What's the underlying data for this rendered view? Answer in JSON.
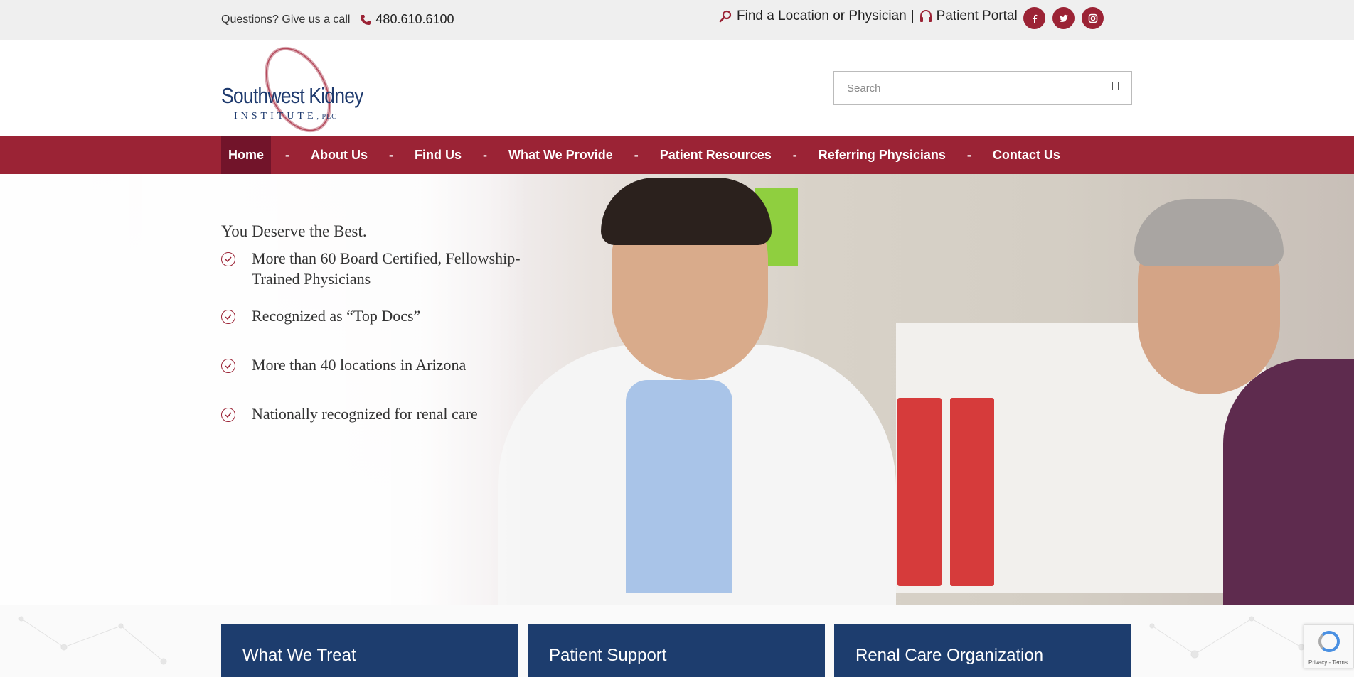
{
  "topbar": {
    "call_prompt": "Questions? Give us a call",
    "phone": "480.610.6100",
    "find_link": "Find a Location or Physician",
    "separator": "|",
    "portal_link": "Patient Portal",
    "social": [
      {
        "icon": "facebook-icon",
        "glyph": "f"
      },
      {
        "icon": "twitter-icon",
        "glyph": "t"
      },
      {
        "icon": "instagram-icon",
        "glyph": "ig"
      }
    ]
  },
  "header": {
    "logo_name": "Southwest Kidney",
    "logo_sub": "INSTITUTE",
    "logo_plc": ", PLC",
    "search_placeholder": "Search"
  },
  "nav": {
    "items": [
      "Home",
      "About Us",
      "Find Us",
      "What We Provide",
      "Patient Resources",
      "Referring Physicians",
      "Contact Us"
    ],
    "separator": "-",
    "active": "Home"
  },
  "hero": {
    "heading": "You Deserve the Best.",
    "points": [
      "More than 60 Board Certified, Fellowship-Trained Physicians",
      "Recognized as “Top Docs”",
      "More than 40 locations in Arizona",
      "Nationally recognized for renal care"
    ]
  },
  "cards": [
    "What We Treat",
    "Patient Support",
    "Renal Care Organization"
  ],
  "recaptcha": {
    "label": "Privacy - Terms"
  },
  "colors": {
    "brand": "#9b2335",
    "brand_dark": "#72142a",
    "navy": "#1d3d6e",
    "topbar_bg": "#efefef"
  }
}
